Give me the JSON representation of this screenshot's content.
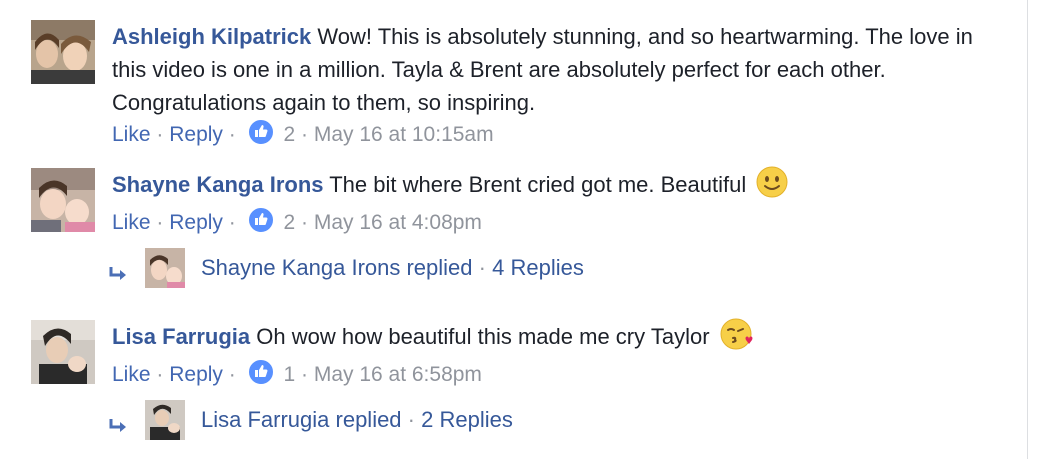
{
  "comments": [
    {
      "author": "Ashleigh Kilpatrick",
      "text": "Wow! This is absolutely stunning, and so heartwarming. The love in this video is one in a million. Tayla & Brent are absolutely perfect for each other. Congratulations again to them, so inspiring.",
      "like_label": "Like",
      "reply_label": "Reply",
      "like_count": "2",
      "timestamp": "May 16 at 10:15am",
      "emoji": ""
    },
    {
      "author": "Shayne Kanga Irons",
      "text": "The bit where Brent cried got me. Beautiful",
      "like_label": "Like",
      "reply_label": "Reply",
      "like_count": "2",
      "timestamp": "May 16 at 4:08pm",
      "emoji": "slightly-smiling-face",
      "replies_summary": {
        "replier": "Shayne Kanga Irons replied",
        "count_text": "4 Replies"
      }
    },
    {
      "author": "Lisa Farrugia",
      "text": "Oh wow how beautiful this made me cry Taylor",
      "like_label": "Like",
      "reply_label": "Reply",
      "like_count": "1",
      "timestamp": "May 16 at 6:58pm",
      "emoji": "face-blowing-kiss",
      "replies_summary": {
        "replier": "Lisa Farrugia replied",
        "count_text": "2 Replies"
      }
    }
  ],
  "separator": "·",
  "colors": {
    "author": "#365899",
    "link": "#4267b2",
    "meta": "#90949c",
    "like_badge": "#5890ff"
  }
}
